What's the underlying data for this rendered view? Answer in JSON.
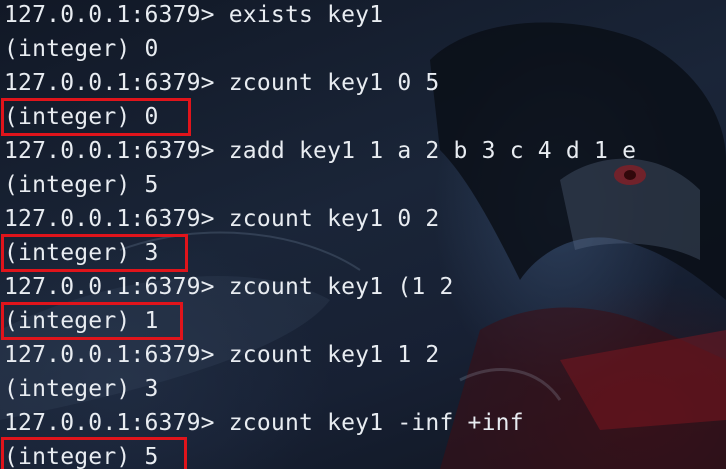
{
  "terminal": {
    "lines": [
      "127.0.0.1:6379> exists key1",
      "(integer) 0",
      "127.0.0.1:6379> zcount key1 0 5",
      "(integer) 0",
      "127.0.0.1:6379> zadd key1 1 a 2 b 3 c 4 d 1 e",
      "(integer) 5",
      "127.0.0.1:6379> zcount key1 0 2",
      "(integer) 3",
      "127.0.0.1:6379> zcount key1 (1 2",
      "(integer) 1",
      "127.0.0.1:6379> zcount key1 1 2",
      "(integer) 3",
      "127.0.0.1:6379> zcount key1 -inf +inf",
      "(integer) 5"
    ]
  },
  "colors": {
    "text": "#e8ecf1",
    "highlight_border": "#e0141b"
  }
}
